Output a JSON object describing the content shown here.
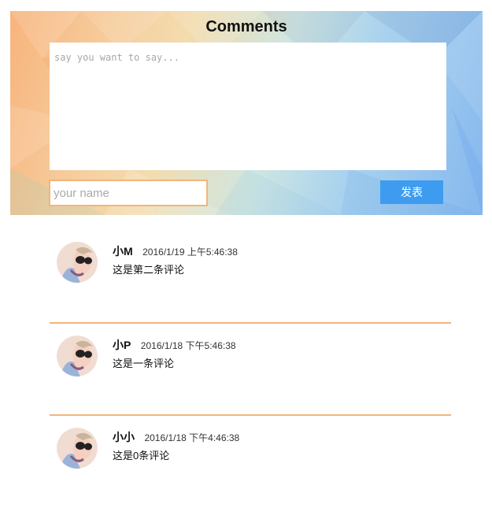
{
  "composer": {
    "title": "Comments",
    "textarea_placeholder": "say you want to say...",
    "name_placeholder": "your name",
    "submit_label": "发表"
  },
  "comments": [
    {
      "name": "小M",
      "time": "2016/1/19 上午5:46:38",
      "text": "这是第二条评论"
    },
    {
      "name": "小P",
      "time": "2016/1/18 下午5:46:38",
      "text": "这是一条评论"
    },
    {
      "name": "小小",
      "time": "2016/1/18 下午4:46:38",
      "text": "这是0条评论"
    }
  ],
  "colors": {
    "accent_border": "#f2b57d",
    "button_bg": "#3d9cf0",
    "gradient_warm": "#f7b47c",
    "gradient_cool": "#86b8ee"
  },
  "icons": {
    "avatar": "user-avatar-photo"
  }
}
